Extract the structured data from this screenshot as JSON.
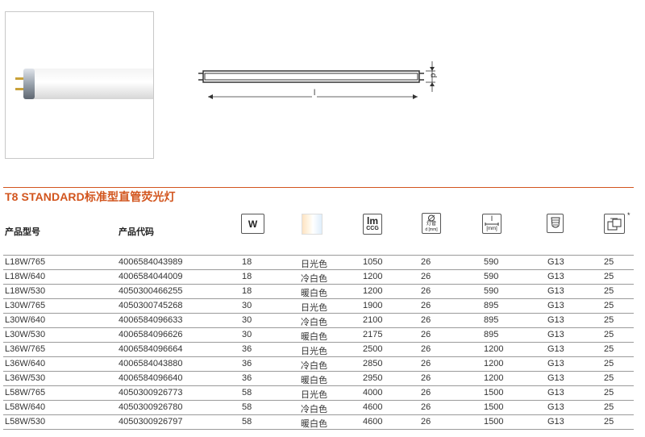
{
  "section_title": "T8 STANDARD标准型直管荧光灯",
  "headers": {
    "model": "产品型号",
    "code": "产品代码",
    "watt_icon_text": "W",
    "lumen_icon_top": "lm",
    "lumen_icon_bottom": "CCG",
    "diameter_icon_text": "灯管",
    "diameter_icon_unit": "d [mm]",
    "length_icon_text": "l",
    "length_icon_unit": "[mm]",
    "pack_asterisk": "*"
  },
  "diagram": {
    "d_label": "d",
    "l_label": "l"
  },
  "rows": [
    [
      "L18W/765",
      "4006584043989",
      "18",
      "日光色",
      "1050",
      "26",
      "590",
      "G13",
      "25"
    ],
    [
      "L18W/640",
      "4006584044009",
      "18",
      "冷白色",
      "1200",
      "26",
      "590",
      "G13",
      "25"
    ],
    [
      "L18W/530",
      "4050300466255",
      "18",
      "暖白色",
      "1200",
      "26",
      "590",
      "G13",
      "25"
    ],
    [
      "L30W/765",
      "4050300745268",
      "30",
      "日光色",
      "1900",
      "26",
      "895",
      "G13",
      "25"
    ],
    [
      "L30W/640",
      "4006584096633",
      "30",
      "冷白色",
      "2100",
      "26",
      "895",
      "G13",
      "25"
    ],
    [
      "L30W/530",
      "4006584096626",
      "30",
      "暖白色",
      "2175",
      "26",
      "895",
      "G13",
      "25"
    ],
    [
      "L36W/765",
      "4006584096664",
      "36",
      "日光色",
      "2500",
      "26",
      "1200",
      "G13",
      "25"
    ],
    [
      "L36W/640",
      "4006584043880",
      "36",
      "冷白色",
      "2850",
      "26",
      "1200",
      "G13",
      "25"
    ],
    [
      "L36W/530",
      "4006584096640",
      "36",
      "暖白色",
      "2950",
      "26",
      "1200",
      "G13",
      "25"
    ],
    [
      "L58W/765",
      "4050300926773",
      "58",
      "日光色",
      "4000",
      "26",
      "1500",
      "G13",
      "25"
    ],
    [
      "L58W/640",
      "4050300926780",
      "58",
      "冷白色",
      "4600",
      "26",
      "1500",
      "G13",
      "25"
    ],
    [
      "L58W/530",
      "4050300926797",
      "58",
      "暖白色",
      "4600",
      "26",
      "1500",
      "G13",
      "25"
    ]
  ],
  "colors": {
    "accent": "#d2551e",
    "rule": "#9a9a9a",
    "text": "#333333"
  }
}
